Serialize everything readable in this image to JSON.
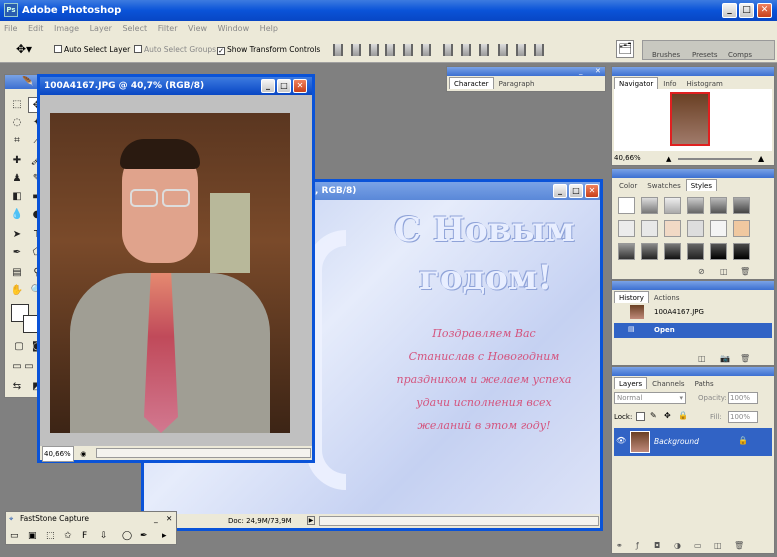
{
  "app": {
    "title": "Adobe Photoshop"
  },
  "menu": [
    "File",
    "Edit",
    "Image",
    "Layer",
    "Select",
    "Filter",
    "View",
    "Window",
    "Help"
  ],
  "options": {
    "auto_select_layer": "Auto Select Layer",
    "auto_select_groups": "Auto Select Groups",
    "show_transform_controls": "Show Transform Controls",
    "well_tabs": [
      "Brushes",
      "Presets",
      "Comps"
    ]
  },
  "doc1": {
    "title": "100A4167.JPG @ 40,7% (RGB/8)",
    "zoom": "40,66%"
  },
  "doc2": {
    "title": ", RGB/8)",
    "doc_info": "Doc: 24,9M/73,9M",
    "card_title_line1": "С Новым",
    "card_title_line2": "годом!",
    "card_lines": [
      "Поздравляем Вас",
      "Станислав с Новогодним",
      "праздником и желаем успеха",
      "удачи исполнения всех",
      "желаний в этом году!"
    ]
  },
  "panels": {
    "char_tabs": [
      "Character",
      "Paragraph"
    ],
    "nav_tabs": [
      "Navigator",
      "Info",
      "Histogram"
    ],
    "nav_zoom": "40,66%",
    "color_tabs": [
      "Color",
      "Swatches",
      "Styles"
    ],
    "history_tabs": [
      "History",
      "Actions"
    ],
    "history_snapshot": "100A4167.JPG",
    "history_open": "Open",
    "layers_tabs": [
      "Layers",
      "Channels",
      "Paths"
    ],
    "blend_mode": "Normal",
    "opacity_label": "Opacity:",
    "opacity_value": "100%",
    "lock_label": "Lock:",
    "fill_label": "Fill:",
    "fill_value": "100%",
    "layer_name": "Background"
  },
  "faststone": {
    "title": "FastStone Capture"
  },
  "colors": {
    "xp_blue": "#0a53d8",
    "workspace": "#808080",
    "selection": "#3163c5"
  }
}
